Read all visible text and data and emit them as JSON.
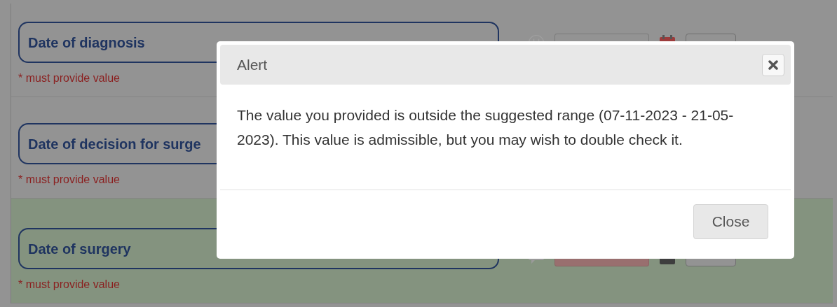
{
  "fields": [
    {
      "label": "Date of diagnosis",
      "note": "* must provide value",
      "highlighted": false,
      "invalid": false
    },
    {
      "label": "Date of decision for surge",
      "note": "* must provide value",
      "highlighted": false
    },
    {
      "label": "Date of surgery",
      "note": "* must provide value",
      "highlighted": true,
      "invalid": true
    }
  ],
  "dialog": {
    "title": "Alert",
    "message": "The value you provided is outside the suggested range (07-11-2023 - 21-05-2023). This value is admissible, but you may wish to double check it.",
    "buttons": [
      "Close"
    ]
  }
}
